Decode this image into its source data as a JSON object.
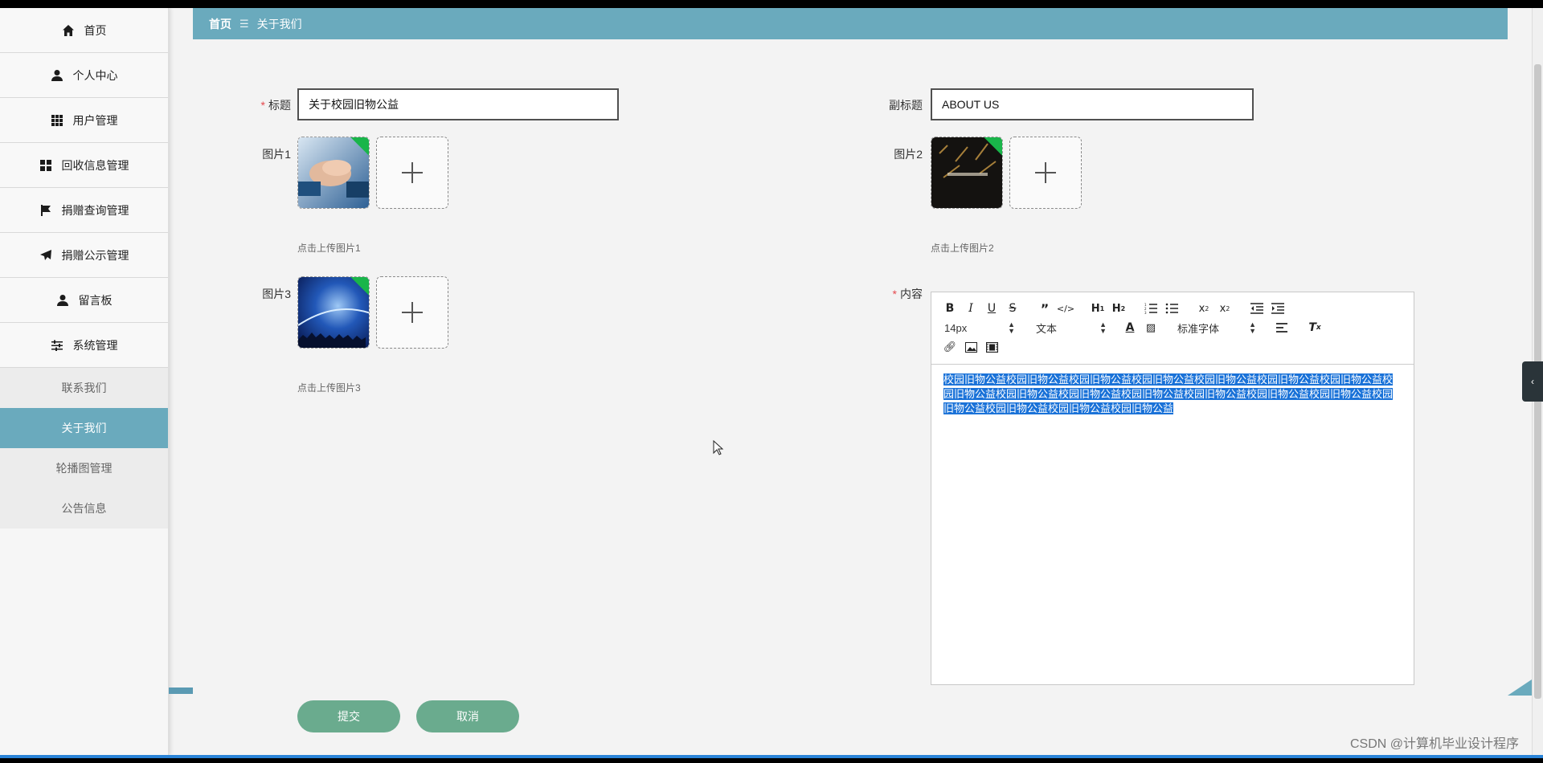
{
  "sidebar": {
    "items": [
      {
        "label": "首页",
        "icon": "home-icon"
      },
      {
        "label": "个人中心",
        "icon": "user-icon"
      },
      {
        "label": "用户管理",
        "icon": "grid-icon"
      },
      {
        "label": "回收信息管理",
        "icon": "dashboard-icon"
      },
      {
        "label": "捐赠查询管理",
        "icon": "flag-icon"
      },
      {
        "label": "捐赠公示管理",
        "icon": "send-icon"
      },
      {
        "label": "留言板",
        "icon": "user-icon"
      },
      {
        "label": "系统管理",
        "icon": "sliders-icon"
      }
    ],
    "sub_items": [
      {
        "label": "联系我们",
        "active": false
      },
      {
        "label": "关于我们",
        "active": true
      },
      {
        "label": "轮播图管理",
        "active": false
      },
      {
        "label": "公告信息",
        "active": false
      }
    ]
  },
  "breadcrumb": {
    "home": "首页",
    "separator": "☰",
    "current": "关于我们"
  },
  "form": {
    "title_label": "标题",
    "title_value": "关于校园旧物公益",
    "subtitle_label": "副标题",
    "subtitle_value": "ABOUT US",
    "image1_label": "图片1",
    "image1_hint": "点击上传图片1",
    "image2_label": "图片2",
    "image2_hint": "点击上传图片2",
    "image3_label": "图片3",
    "image3_hint": "点击上传图片3",
    "content_label": "内容",
    "content_text": "校园旧物公益校园旧物公益校园旧物公益校园旧物公益校园旧物公益校园旧物公益校园旧物公益校园旧物公益校园旧物公益校园旧物公益校园旧物公益校园旧物公益校园旧物公益校园旧物公益校园旧物公益校园旧物公益校园旧物公益校园旧物公益"
  },
  "editor": {
    "font_size": "14px",
    "format": "文本",
    "font_family": "标准字体"
  },
  "buttons": {
    "submit": "提交",
    "cancel": "取消"
  },
  "watermark": "CSDN @计算机毕业设计程序",
  "colors": {
    "accent": "#6aaabd",
    "button": "#6aab8e",
    "selection": "#1a72d8"
  }
}
